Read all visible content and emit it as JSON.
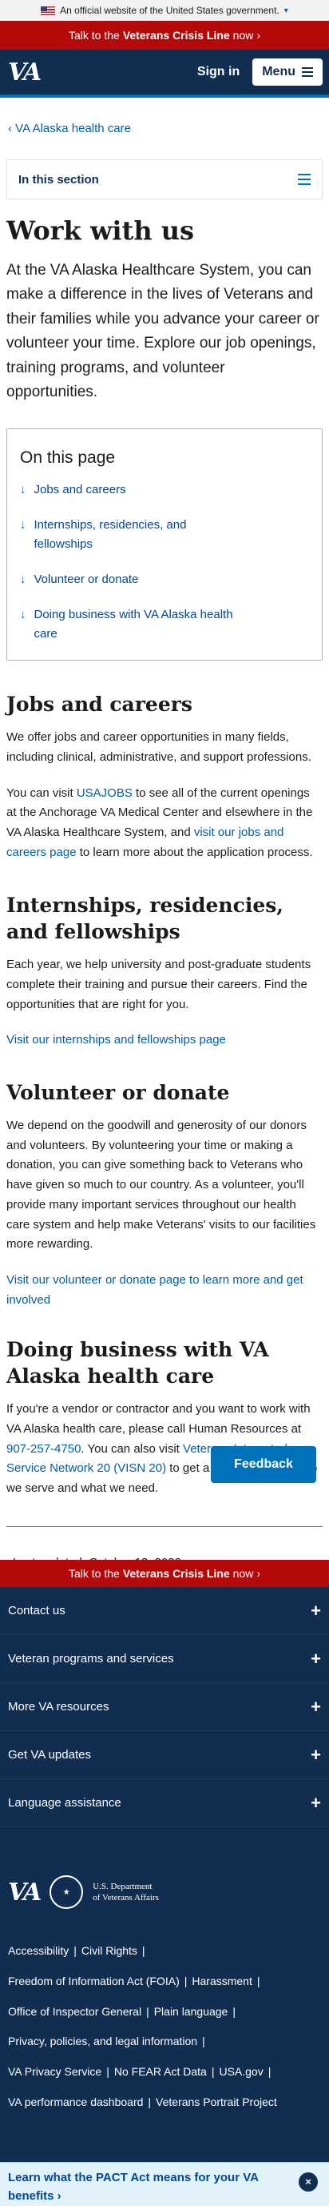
{
  "gov_banner": {
    "text": "An official website of the United States government.",
    "chevron": "chevron-down-icon"
  },
  "crisis_line": {
    "prefix": "Talk to the ",
    "bold": "Veterans Crisis Line",
    "suffix": " now",
    "chevron": "›"
  },
  "header": {
    "logo": "VA",
    "signin": "Sign in",
    "menu": "Menu"
  },
  "breadcrumb": {
    "back": "‹",
    "label": "VA Alaska health care"
  },
  "in_section": "In this section",
  "page_title": "Work with us",
  "intro": "At the VA Alaska Healthcare System, you can make a difference in the lives of Veterans and their families while you advance your career or volunteer your time. Explore our job openings, training programs, and volunteer opportunities.",
  "on_this_page": {
    "title": "On this page",
    "arrow": "↓",
    "items": [
      "Jobs and careers",
      "Internships, residencies, and fellowships",
      "Volunteer or donate",
      "Doing business with VA Alaska health care"
    ]
  },
  "sections": {
    "jobs": {
      "title": "Jobs and careers",
      "p1": "We offer jobs and career opportunities in many fields, including clinical, administrative, and support professions.",
      "p2_a": "You can visit ",
      "p2_link1": "USAJOBS",
      "p2_b": " to see all of the current openings at the Anchorage VA Medical Center and elsewhere in the VA Alaska Healthcare System, and ",
      "p2_link2": "visit our jobs and careers page",
      "p2_c": " to learn more about the application process."
    },
    "internships": {
      "title": "Internships, residencies, and fellowships",
      "p1": "Each year, we help university and post-graduate students complete their training and pursue their careers. Find the opportunities that are right for you.",
      "link": "Visit our internships and fellowships page"
    },
    "volunteer": {
      "title": "Volunteer or donate",
      "p1": "We depend on the goodwill and generosity of our donors and volunteers. By volunteering your time or making a donation, you can give something back to Veterans who have given so much to our country. As a volunteer, you'll provide many important services throughout our health care system and help make Veterans' visits to our facilities more rewarding.",
      "link": "Visit our volunteer or donate page to learn more and get involved"
    },
    "business": {
      "title": "Doing business with VA Alaska health care",
      "p_a": "If you're a vendor or contractor and you want to work with VA Alaska health care, please call Human Resources at ",
      "phone": "907-257-4750",
      "p_b": ". You can also visit ",
      "visn": "Veterans Integrated Service Network 20 (VISN 20)",
      "p_c": " to get a better sense of who we serve and what we need."
    }
  },
  "last_updated": "Last updated: October 13, 2022",
  "feedback": "Feedback",
  "footer": {
    "accordions": [
      "Contact us",
      "Veteran programs and services",
      "More VA resources",
      "Get VA updates",
      "Language assistance"
    ],
    "plus": "+",
    "logo": "VA",
    "dept_line1": "U.S. Department",
    "dept_line2": "of Veterans Affairs",
    "links": [
      [
        "Accessibility",
        "Civil Rights"
      ],
      [
        "Freedom of Information Act (FOIA)",
        "Harassment"
      ],
      [
        "Office of Inspector General",
        "Plain language"
      ],
      [
        "Privacy, policies, and legal information"
      ],
      [
        "VA Privacy Service",
        "No FEAR Act Data",
        "USA.gov"
      ],
      [
        "VA performance dashboard",
        "Veterans Portrait Project"
      ]
    ]
  },
  "pact": {
    "text": "Learn what the PACT Act means for your VA benefits ›",
    "close": "×"
  }
}
